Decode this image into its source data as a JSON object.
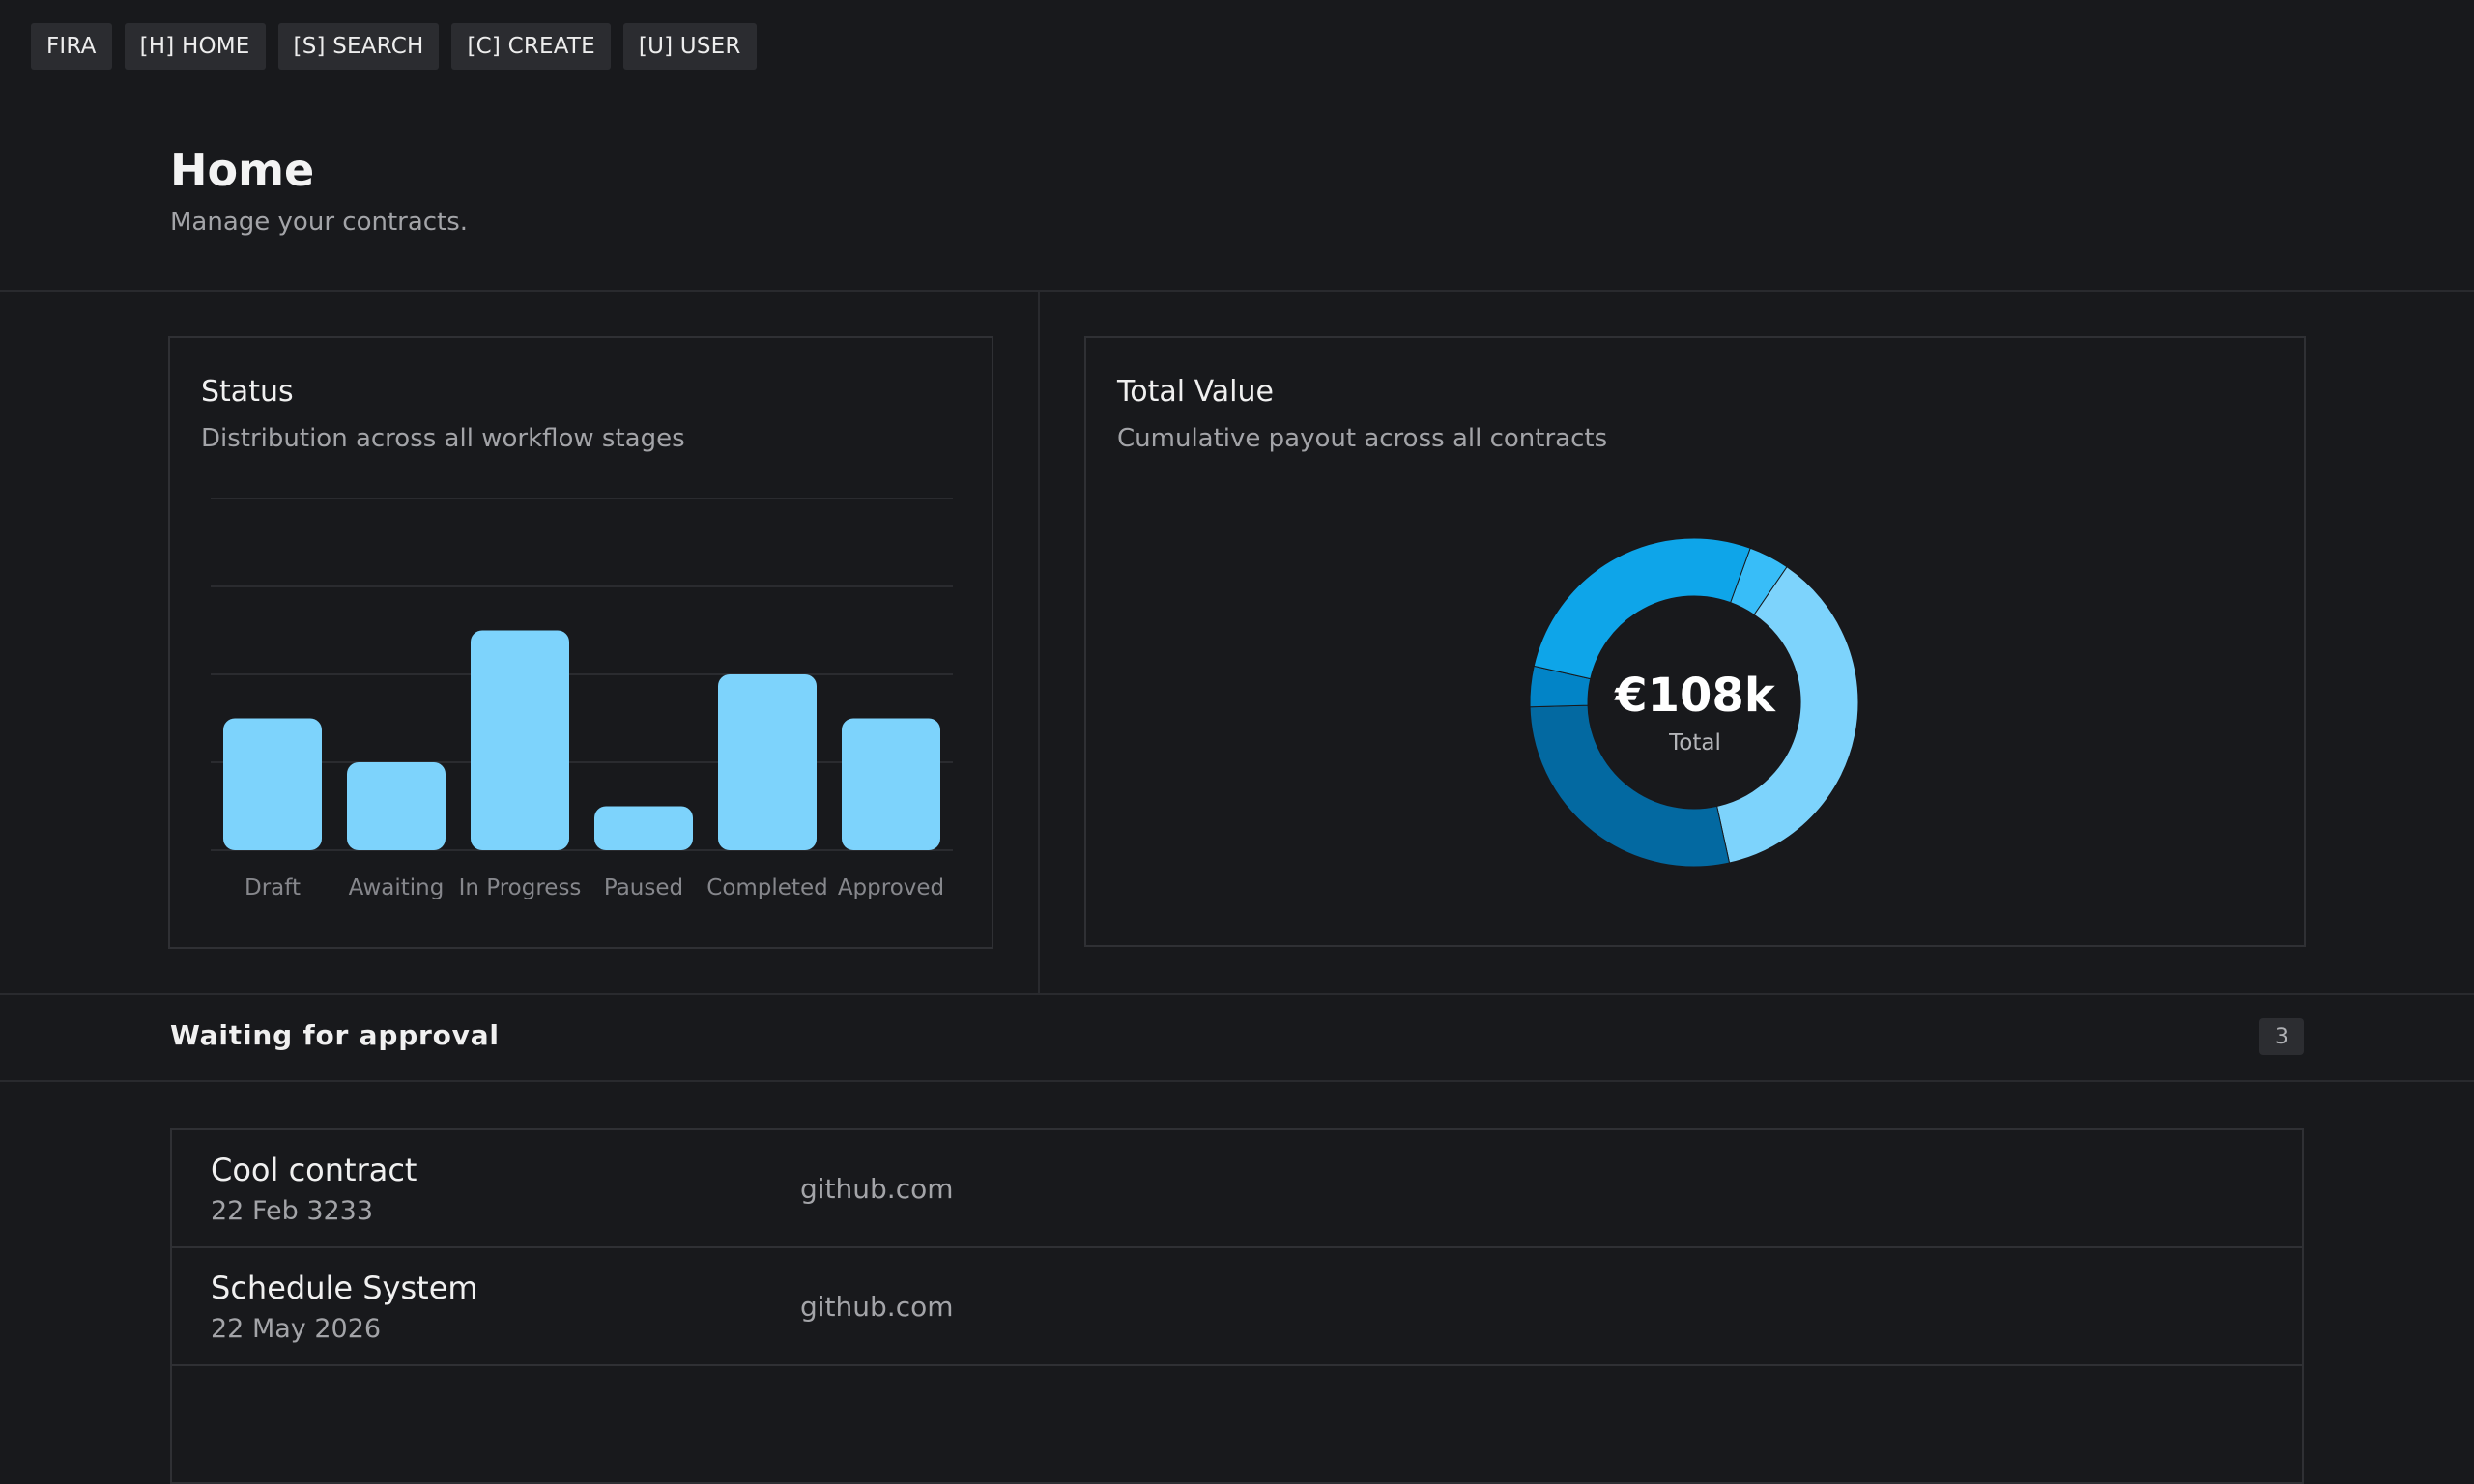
{
  "nav": {
    "items": [
      {
        "label": "FIRA",
        "name": "nav-fira"
      },
      {
        "label": "[H] HOME",
        "name": "nav-home"
      },
      {
        "label": "[S] SEARCH",
        "name": "nav-search"
      },
      {
        "label": "[C] CREATE",
        "name": "nav-create"
      },
      {
        "label": "[U] USER",
        "name": "nav-user"
      }
    ]
  },
  "header": {
    "title": "Home",
    "subtitle": "Manage your contracts."
  },
  "status_card": {
    "title": "Status",
    "subtitle": "Distribution across all workflow stages"
  },
  "value_card": {
    "title": "Total Value",
    "subtitle": "Cumulative payout across all contracts",
    "total": "€108k",
    "total_label": "Total"
  },
  "chart_data": [
    {
      "type": "bar",
      "categories": [
        "Draft",
        "Awaiting",
        "In Progress",
        "Paused",
        "Completed",
        "Approved"
      ],
      "values": [
        3,
        2,
        5,
        1,
        4,
        3
      ],
      "ylim": [
        0,
        8
      ],
      "grid": true,
      "color": "#7dd3fc"
    },
    {
      "type": "pie",
      "variant": "donut",
      "values": [
        4,
        37,
        28,
        4,
        27
      ],
      "colors": [
        "#38bdf8",
        "#7dd3fc",
        "#0369a1",
        "#0284c7",
        "#0ea5e9"
      ]
    }
  ],
  "approval": {
    "title": "Waiting for approval",
    "count": "3",
    "rows": [
      {
        "title": "Cool contract",
        "date": "22 Feb 3233",
        "domain": "github.com"
      },
      {
        "title": "Schedule System",
        "date": "22 May 2026",
        "domain": "github.com"
      },
      {
        "title": "",
        "date": "",
        "domain": ""
      }
    ]
  }
}
